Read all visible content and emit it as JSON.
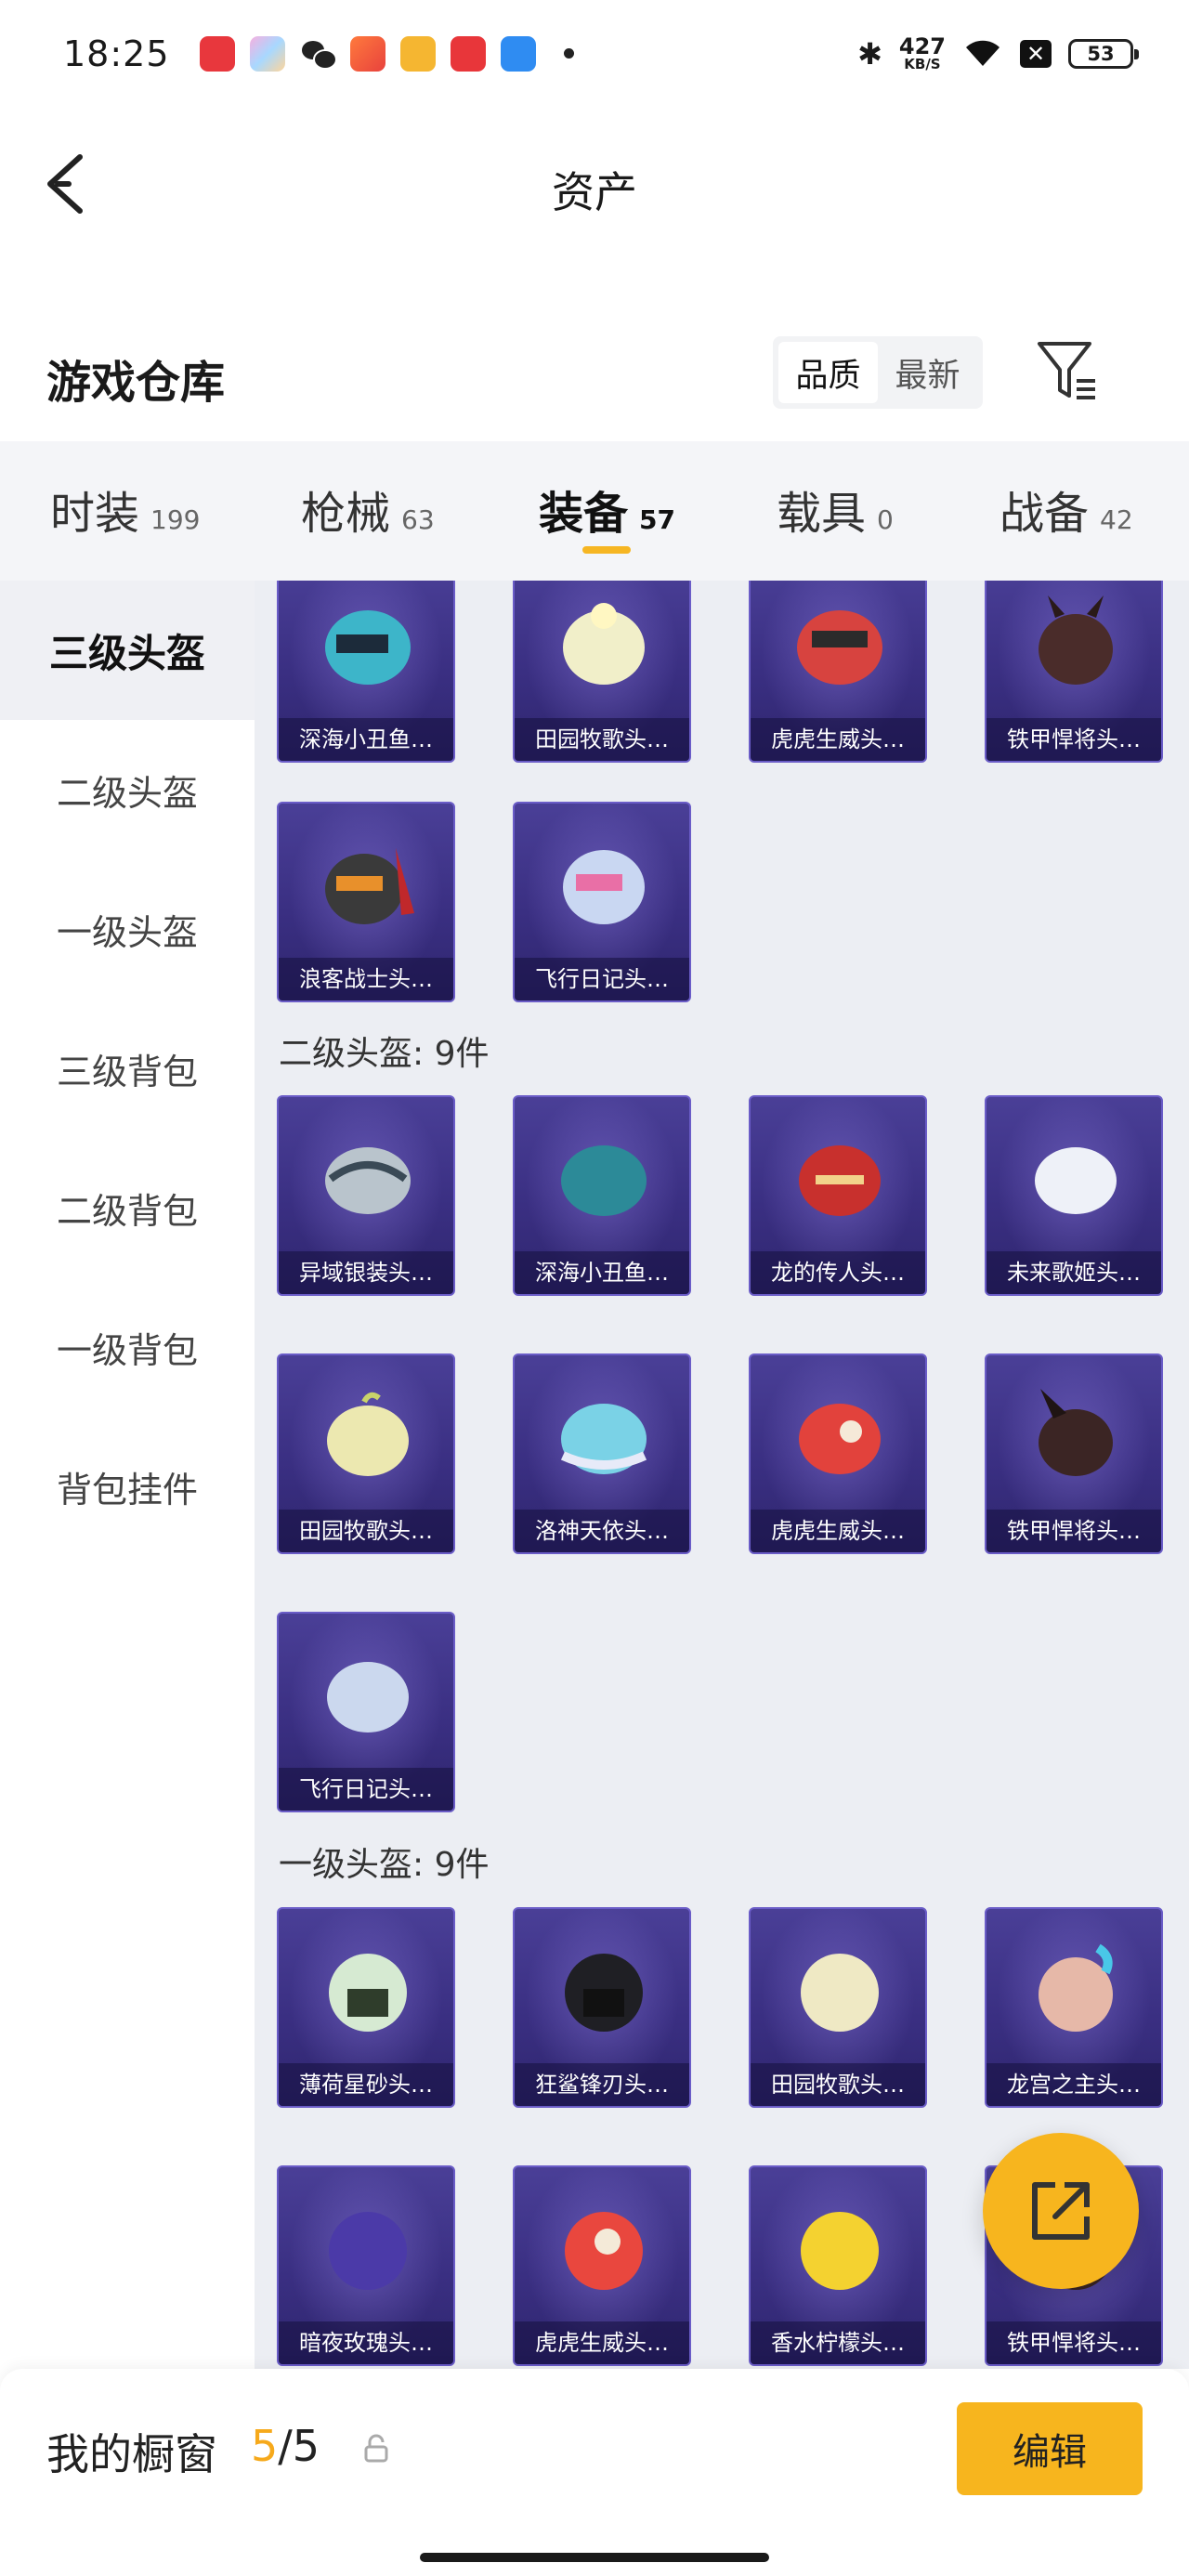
{
  "status_bar": {
    "time": "18:25",
    "speed_value": "427",
    "speed_unit": "KB/S",
    "battery": "53",
    "notification_icons": [
      "music-app-icon",
      "photos-app-icon",
      "wechat-icon",
      "game-center-icon",
      "books-app-icon",
      "taobao-icon",
      "calendar-app-icon"
    ]
  },
  "header": {
    "title": "资产"
  },
  "warehouse": {
    "title": "游戏仓库",
    "sort_options": [
      "品质",
      "最新"
    ],
    "sort_active": "品质"
  },
  "category_tabs": [
    {
      "label": "时装",
      "count": "199"
    },
    {
      "label": "枪械",
      "count": "63"
    },
    {
      "label": "装备",
      "count": "57",
      "active": true
    },
    {
      "label": "载具",
      "count": "0"
    },
    {
      "label": "战备",
      "count": "42"
    }
  ],
  "sidebar": {
    "items": [
      "三级头盔",
      "二级头盔",
      "一级头盔",
      "三级背包",
      "二级背包",
      "一级背包",
      "背包挂件"
    ],
    "active": "三级头盔"
  },
  "sections": [
    {
      "title": "",
      "items": [
        "深海小丑鱼…",
        "田园牧歌头…",
        "虎虎生威头…",
        "铁甲悍将头…",
        "浪客战士头…",
        "飞行日记头…"
      ]
    },
    {
      "title": "二级头盔: 9件",
      "items": [
        "异域银装头…",
        "深海小丑鱼…",
        "龙的传人头…",
        "未来歌姬头…",
        "田园牧歌头…",
        "洛神天依头…",
        "虎虎生威头…",
        "铁甲悍将头…",
        "飞行日记头…"
      ]
    },
    {
      "title": "一级头盔: 9件",
      "items": [
        "薄荷星砂头…",
        "狂鲨锋刃头…",
        "田园牧歌头…",
        "龙宫之主头…",
        "暗夜玫瑰头…",
        "虎虎生威头…",
        "香水柠檬头…",
        "铁甲悍将头…"
      ]
    }
  ],
  "colors": {
    "accent": "#f7b51e",
    "card_bg": "#3a2f82",
    "content_bg": "#eceef3"
  },
  "bottom_bar": {
    "label": "我的橱窗",
    "count_used": "5",
    "count_sep": "/",
    "count_total": "5",
    "edit_label": "编辑"
  }
}
